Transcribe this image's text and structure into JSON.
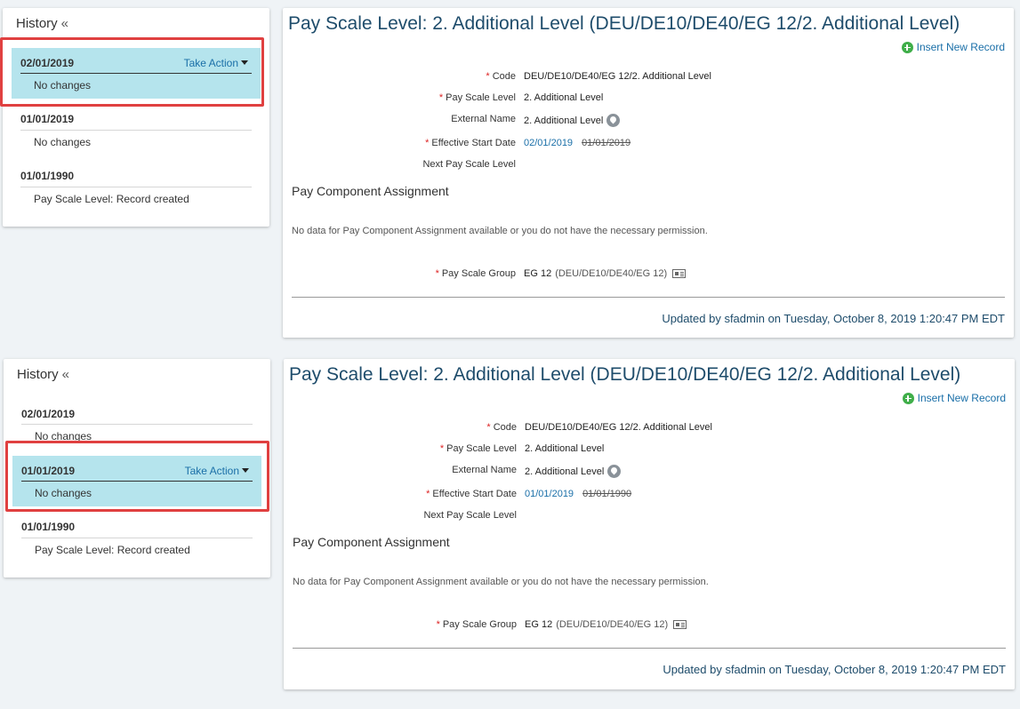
{
  "panels": [
    {
      "history": {
        "title": "History",
        "collapse_glyph": "«",
        "entries": [
          {
            "date": "02/01/2019",
            "desc": "No changes",
            "action": "Take Action",
            "selected": true
          },
          {
            "date": "01/01/2019",
            "desc": "No changes"
          },
          {
            "date": "01/01/1990",
            "desc": "Pay Scale Level: Record created"
          }
        ]
      },
      "detail": {
        "title": "Pay Scale Level: 2. Additional Level (DEU/DE10/DE40/EG 12/2. Additional Level)",
        "insert_label": "Insert New Record",
        "fields": {
          "code": {
            "label": "Code",
            "value": "DEU/DE10/DE40/EG 12/2. Additional Level"
          },
          "level": {
            "label": "Pay Scale Level",
            "value": "2. Additional Level"
          },
          "external": {
            "label": "External Name",
            "value": "2. Additional Level"
          },
          "start": {
            "label": "Effective Start Date",
            "value": "02/01/2019",
            "old": "01/01/2019"
          },
          "next": {
            "label": "Next Pay Scale Level"
          }
        },
        "section_title": "Pay Component Assignment",
        "no_data": "No data for Pay Component Assignment available or you do not have the necessary permission.",
        "group": {
          "label": "Pay Scale Group",
          "value": "EG 12",
          "sub": "(DEU/DE10/DE40/EG 12)"
        },
        "updated": "Updated by sfadmin on Tuesday, October 8, 2019 1:20:47 PM EDT"
      }
    },
    {
      "history": {
        "title": "History",
        "collapse_glyph": "«",
        "entries": [
          {
            "date": "02/01/2019",
            "desc": "No changes"
          },
          {
            "date": "01/01/2019",
            "desc": "No changes",
            "action": "Take Action",
            "selected": true
          },
          {
            "date": "01/01/1990",
            "desc": "Pay Scale Level: Record created"
          }
        ]
      },
      "detail": {
        "title": "Pay Scale Level: 2. Additional Level (DEU/DE10/DE40/EG 12/2. Additional Level)",
        "insert_label": "Insert New Record",
        "fields": {
          "code": {
            "label": "Code",
            "value": "DEU/DE10/DE40/EG 12/2. Additional Level"
          },
          "level": {
            "label": "Pay Scale Level",
            "value": "2. Additional Level"
          },
          "external": {
            "label": "External Name",
            "value": "2. Additional Level"
          },
          "start": {
            "label": "Effective Start Date",
            "value": "01/01/2019",
            "old": "01/01/1990"
          },
          "next": {
            "label": "Next Pay Scale Level"
          }
        },
        "section_title": "Pay Component Assignment",
        "no_data": "No data for Pay Component Assignment available or you do not have the necessary permission.",
        "group": {
          "label": "Pay Scale Group",
          "value": "EG 12",
          "sub": "(DEU/DE10/DE40/EG 12)"
        },
        "updated": "Updated by sfadmin on Tuesday, October 8, 2019 1:20:47 PM EDT"
      }
    }
  ],
  "colors": {
    "accent": "#1a6fa8",
    "selected_bg": "#b5e4ed",
    "highlight_border": "#e04040",
    "title": "#1e4c6b"
  }
}
